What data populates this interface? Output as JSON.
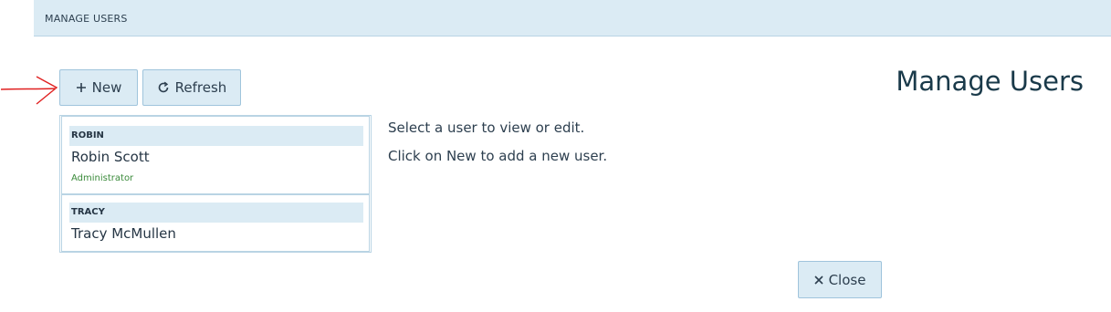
{
  "header": {
    "title": "MANAGE USERS"
  },
  "toolbar": {
    "new_label": "New",
    "new_icon": "plus-icon",
    "refresh_label": "Refresh",
    "refresh_icon": "refresh-icon"
  },
  "page": {
    "title": "Manage Users"
  },
  "users": [
    {
      "code": "ROBIN",
      "name": "Robin Scott",
      "role": "Administrator"
    },
    {
      "code": "TRACY",
      "name": "Tracy McMullen"
    }
  ],
  "hints": {
    "line1": "Select a user to view or edit.",
    "line2": "Click on New to add a new user."
  },
  "footer": {
    "close_label": "Close",
    "close_icon": "close-icon"
  },
  "colors": {
    "accent_bg": "#dbebf4",
    "border": "#9fc4dc",
    "role_text": "#3a8a3a",
    "annotation_arrow": "#e02020"
  }
}
